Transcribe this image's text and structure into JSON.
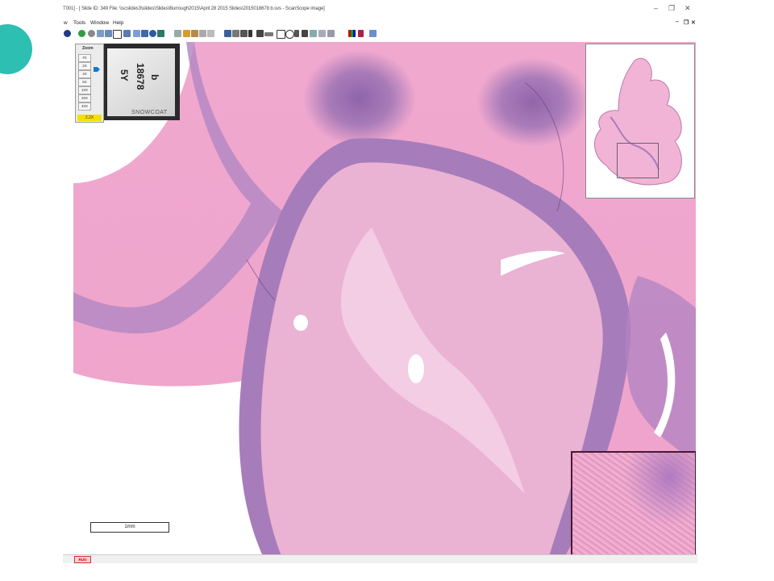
{
  "window": {
    "title": "T001] - [ Slide ID: 349  File: \\\\scslides3\\slides\\Slides\\Burrough2015\\April 28 2015 Slides\\2015018678 b.svs - ScanScope image]",
    "minimize": "–",
    "restore": "❐",
    "close": "✕"
  },
  "menu": {
    "items": [
      "w",
      "Tools",
      "Window",
      "Help"
    ],
    "mdi_min": "–",
    "mdi_restore": "❐",
    "mdi_close": "✕"
  },
  "zoom": {
    "title": "Zoom",
    "levels": [
      "Fit",
      "2X",
      "4X",
      "5X",
      "10X",
      "20X",
      "40X"
    ],
    "current": "2.2X"
  },
  "slide_label": {
    "line1": "5Y",
    "line2": "18678",
    "line3": "b",
    "brand": "SNOWCOAT"
  },
  "scale_bar": {
    "label": "1mm"
  },
  "status": {
    "badge": "RUO"
  },
  "colors": {
    "accent": "#2ebfb3",
    "tissue_pink": "#f0a8cf",
    "tissue_purple": "#9265aa",
    "zoom_current_bg": "#f3e000",
    "zoom_arrow": "#1779d6"
  },
  "icons": {
    "zoom_arrow": "zoom-pointer-icon",
    "toolbar": [
      "nav-icon",
      "tool-icon"
    ]
  }
}
